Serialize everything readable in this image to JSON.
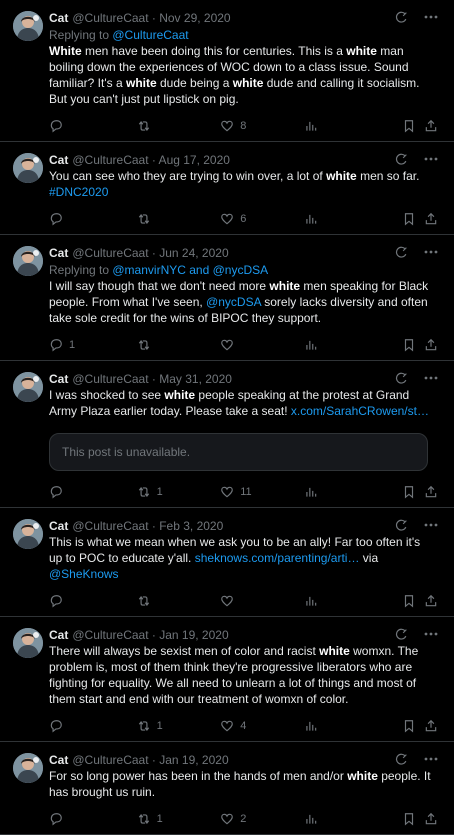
{
  "tweets": [
    {
      "name": "Cat",
      "meta": "@CultureCaat · Nov 29, 2020",
      "reply_prefix": "Replying to ",
      "reply_handles": "@CultureCaat",
      "text_html": "<b>White</b> men have been doing this for centuries. This is a <b>white</b> man boiling down the experiences of WOC down to a class issue. Sound familiar? It's a <b>white</b> dude being a <b>white</b> dude and calling it socialism. But you can't just put lipstick on pig.",
      "replies": "",
      "retweets": "",
      "likes": "8"
    },
    {
      "name": "Cat",
      "meta": "@CultureCaat · Aug 17, 2020",
      "text_html": "You can see who they are trying to win over, a lot of <b>white</b> men so far. <span class=\"link\">#DNC2020</span>",
      "replies": "",
      "retweets": "",
      "likes": "6"
    },
    {
      "name": "Cat",
      "meta": "@CultureCaat · Jun 24, 2020",
      "reply_prefix": "Replying to ",
      "reply_handles": "@manvirNYC and @nycDSA",
      "text_html": "I will say though that we don't need more <b>white</b> men speaking for Black people. From what I've seen, <span class=\"link\">@nycDSA</span> sorely lacks diversity and often take sole credit for the wins of BIPOC they support.",
      "replies": "1",
      "retweets": "",
      "likes": ""
    },
    {
      "name": "Cat",
      "meta": "@CultureCaat · May 31, 2020",
      "text_html": "I was shocked to see <b>white</b> people speaking at the protest at Grand Army Plaza earlier today. Please take a seat! <span class=\"link\">x.com/SarahCRowen/st…</span>",
      "quote": "This post is unavailable.",
      "replies": "",
      "retweets": "1",
      "likes": "11"
    },
    {
      "name": "Cat",
      "meta": "@CultureCaat · Feb 3, 2020",
      "text_html": "This is what we mean when we ask you to be an ally! Far too often it's up to POC to educate y'all. <span class=\"link\">sheknows.com/parenting/arti…</span> via <span class=\"link\">@SheKnows</span>",
      "replies": "",
      "retweets": "",
      "likes": ""
    },
    {
      "name": "Cat",
      "meta": "@CultureCaat · Jan 19, 2020",
      "text_html": "There will always be sexist men of color and racist <b>white</b> womxn. The problem is, most of them think they're progressive liberators who are fighting for equality. We all need to unlearn a lot of things and most of them start and end with our treatment of womxn of color.",
      "replies": "",
      "retweets": "1",
      "likes": "4"
    },
    {
      "name": "Cat",
      "meta": "@CultureCaat · Jan 19, 2020",
      "text_html": "For so long power has been in the hands of men and/or <b>white</b> people. It has brought us ruin.",
      "replies": "",
      "retweets": "1",
      "likes": "2"
    }
  ],
  "icons": {
    "grok": "grok-icon",
    "more": "more-icon",
    "reply": "reply-icon",
    "retweet": "retweet-icon",
    "like": "heart-icon",
    "views": "views-icon",
    "bookmark": "bookmark-icon",
    "share": "share-icon"
  },
  "colors": {
    "background": "#000000",
    "text": "#e7e9ea",
    "muted": "#71767b",
    "link": "#1d9bf0",
    "divider": "#2f3336"
  }
}
